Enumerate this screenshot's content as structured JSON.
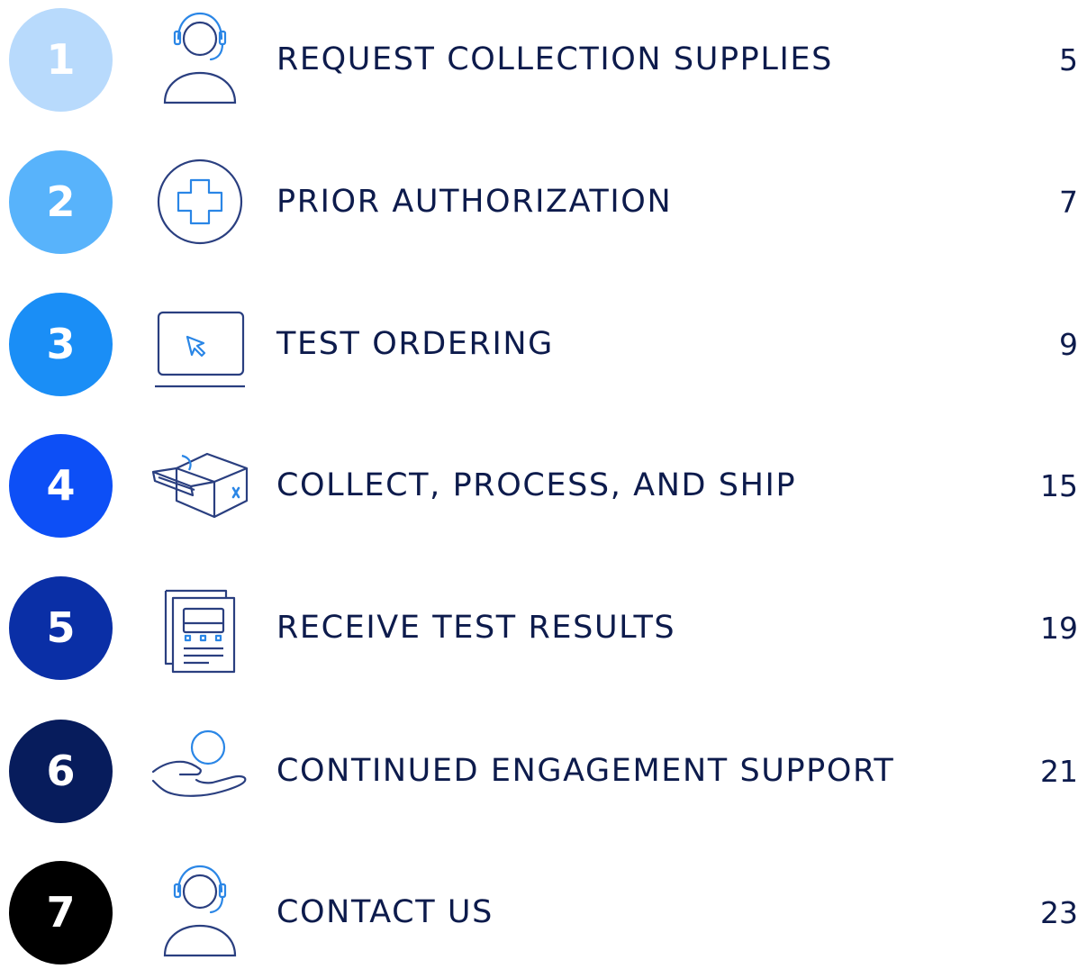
{
  "toc": {
    "items": [
      {
        "number": "1",
        "title": "REQUEST COLLECTION SUPPLIES",
        "page": "5",
        "color": "#b8dafc",
        "icon": "headset-person-icon"
      },
      {
        "number": "2",
        "title": "PRIOR AUTHORIZATION",
        "page": "7",
        "color": "#58b3fb",
        "icon": "medical-cross-icon"
      },
      {
        "number": "3",
        "title": "TEST ORDERING",
        "page": "9",
        "color": "#1a8ef6",
        "icon": "laptop-cursor-icon"
      },
      {
        "number": "4",
        "title": "COLLECT, PROCESS, AND SHIP",
        "page": "15",
        "color": "#0d4ff6",
        "icon": "shipping-box-icon"
      },
      {
        "number": "5",
        "title": "RECEIVE TEST RESULTS",
        "page": "19",
        "color": "#0a2fa6",
        "icon": "report-documents-icon"
      },
      {
        "number": "6",
        "title": "CONTINUED ENGAGEMENT SUPPORT",
        "page": "21",
        "color": "#071c5c",
        "icon": "support-hand-icon"
      },
      {
        "number": "7",
        "title": "CONTACT US",
        "page": "23",
        "color": "#000000",
        "icon": "headset-person-icon"
      }
    ]
  },
  "icon_colors": {
    "line": "#2a3f80",
    "accent": "#2a86e6"
  }
}
